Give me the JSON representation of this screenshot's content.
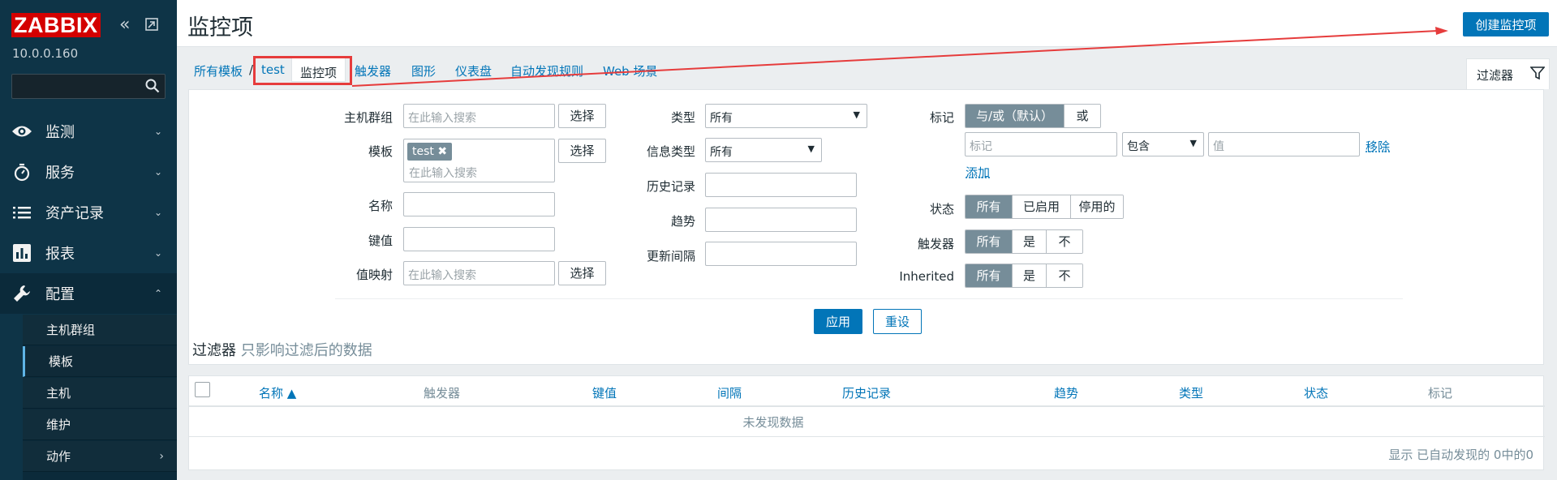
{
  "sidebar": {
    "logo": "ZABBIX",
    "server_ip": "10.0.0.160",
    "menu": [
      {
        "label": "监测",
        "icon": "eye-icon"
      },
      {
        "label": "服务",
        "icon": "stopwatch-icon"
      },
      {
        "label": "资产记录",
        "icon": "list-icon"
      },
      {
        "label": "报表",
        "icon": "bar-chart-icon"
      },
      {
        "label": "配置",
        "icon": "wrench-icon"
      }
    ],
    "submenu": [
      {
        "label": "主机群组"
      },
      {
        "label": "模板"
      },
      {
        "label": "主机"
      },
      {
        "label": "维护"
      },
      {
        "label": "动作"
      }
    ]
  },
  "header": {
    "title": "监控项",
    "create_button": "创建监控项"
  },
  "tabs": {
    "all_templates": "所有模板",
    "separator": "/",
    "template": "test",
    "items": "监控项",
    "triggers": "触发器",
    "graphs": "图形",
    "dashboards": "仪表盘",
    "discovery": "自动发现规则",
    "web": "Web 场景",
    "filter": "过滤器"
  },
  "filter": {
    "host_group_label": "主机群组",
    "host_group_placeholder": "在此输入搜索",
    "template_label": "模板",
    "template_tag": "test",
    "template_placeholder": "在此输入搜索",
    "name_label": "名称",
    "key_label": "键值",
    "valuemap_label": "值映射",
    "valuemap_placeholder": "在此输入搜索",
    "select_button": "选择",
    "type_label": "类型",
    "type_value": "所有",
    "info_type_label": "信息类型",
    "info_type_value": "所有",
    "history_label": "历史记录",
    "trends_label": "趋势",
    "update_interval_label": "更新间隔",
    "tags_label": "标记",
    "tags_andor": "与/或（默认）",
    "tags_or": "或",
    "tag_placeholder": "标记",
    "tag_operator": "包含",
    "tag_value_placeholder": "值",
    "remove_link": "移除",
    "add_link": "添加",
    "state_label": "状态",
    "state_options": [
      "所有",
      "已启用",
      "停用的"
    ],
    "triggers_label": "触发器",
    "triggers_options": [
      "所有",
      "是",
      "不"
    ],
    "inherited_label": "Inherited",
    "inherited_options": [
      "所有",
      "是",
      "不"
    ],
    "apply_button": "应用",
    "reset_button": "重设",
    "note_main": "过滤器",
    "note_sub": "只影响过滤后的数据"
  },
  "table": {
    "columns": [
      "名称 ▲",
      "触发器",
      "键值",
      "间隔",
      "历史记录",
      "趋势",
      "类型",
      "状态",
      "标记"
    ],
    "empty_text": "未发现数据",
    "footer": "显示 已自动发现的 0中的0"
  },
  "colors": {
    "sidebar_bg": "#0e3447",
    "brand_red": "#d40000",
    "accent_blue": "#0275b8",
    "annotation_red": "#e63c3c"
  }
}
